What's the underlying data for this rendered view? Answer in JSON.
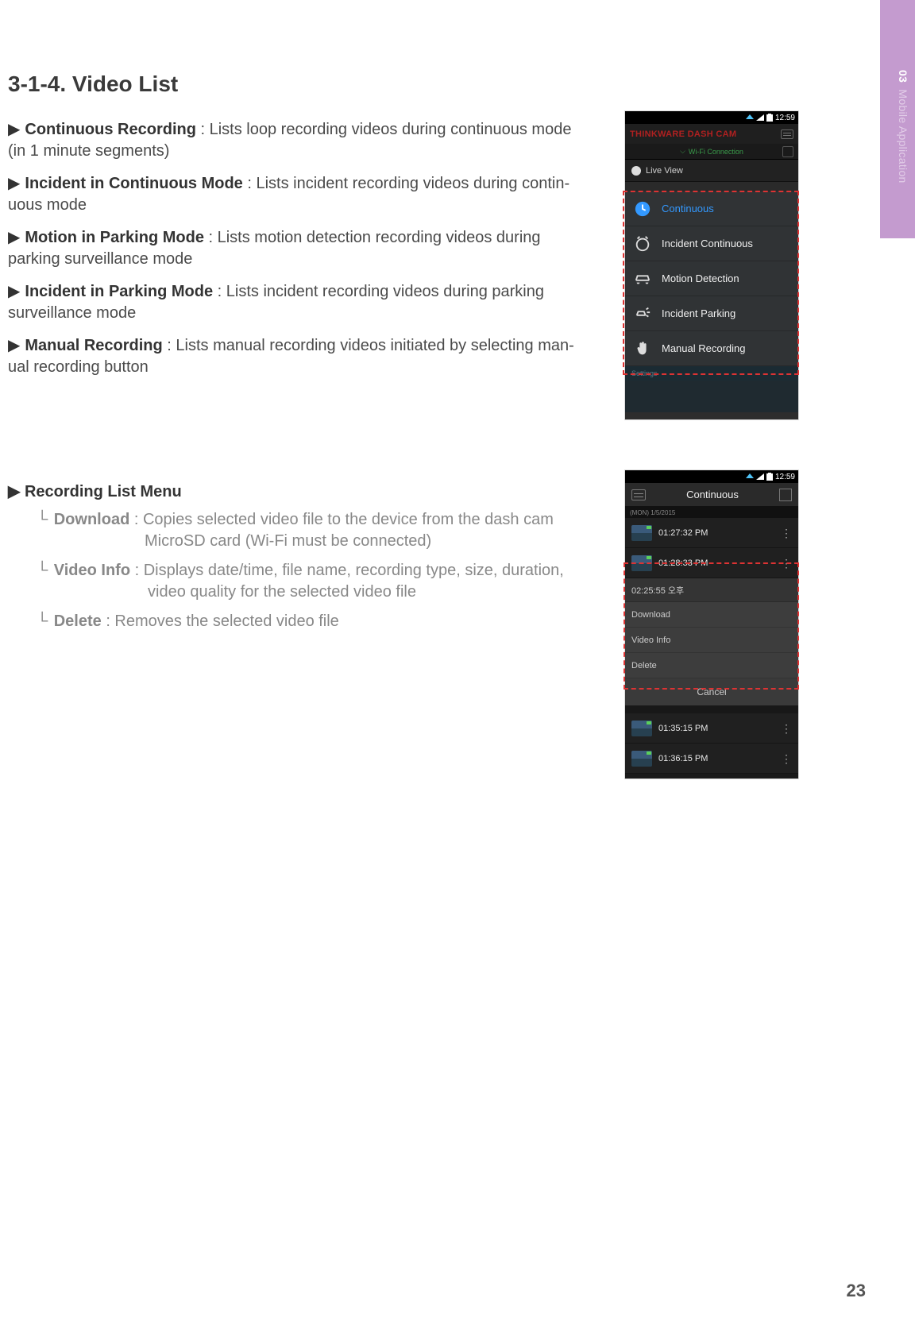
{
  "sidebar": {
    "chapter_num": "03",
    "chapter_title": "Mobile Application"
  },
  "page_number": "23",
  "section_title": "3-1-4. Video List",
  "defs": [
    {
      "term": "Continuous Recording",
      "desc_a": " : Lists loop recording videos during continuous mode",
      "desc_b": "(in 1 minute segments)"
    },
    {
      "term": "Incident in Continuous Mode",
      "desc_a": " : Lists incident recording videos during contin-",
      "desc_b": "uous mode"
    },
    {
      "term": "Motion in Parking Mode",
      "desc_a": " : Lists motion detection recording videos during",
      "desc_b": "parking surveillance mode"
    },
    {
      "term": "Incident in Parking Mode",
      "desc_a": " : Lists incident recording videos during parking",
      "desc_b": "surveillance mode"
    },
    {
      "term": "Manual Recording",
      "desc_a": " : Lists manual recording videos initiated by selecting man-",
      "desc_b": "ual recording button"
    }
  ],
  "rec_menu_title": "Recording List Menu",
  "sub_defs": [
    {
      "term": "Download",
      "desc_a": " : Copies selected video file to the device from the dash cam",
      "desc_b": "MicroSD card (Wi-Fi must be connected)"
    },
    {
      "term": "Video Info",
      "desc_a": " : Displays date/time, file name, recording type, size, duration,",
      "desc_b": "video quality for the selected video file"
    },
    {
      "term": "Delete",
      "desc_a": " : Removes the selected video file",
      "desc_b": ""
    }
  ],
  "phone1": {
    "time": "12:59",
    "title": "THINKWARE DASH CAM",
    "wifi": "Wi-Fi Connection",
    "live": "Live View",
    "categories": [
      "Continuous",
      "Incident Continuous",
      "Motion Detection",
      "Incident Parking",
      "Manual Recording"
    ],
    "settings": "Settings"
  },
  "phone2": {
    "time": "12:59",
    "title": "Continuous",
    "date": "(MON) 1/5/2015",
    "rows": [
      "01:27:32 PM",
      "01:28:33 PM"
    ],
    "sel_time": "02:25:55 오후",
    "popup": [
      "Download",
      "Video Info",
      "Delete"
    ],
    "cancel": "Cancel",
    "after_rows": [
      "01:35:15 PM",
      "01:36:15 PM"
    ]
  }
}
